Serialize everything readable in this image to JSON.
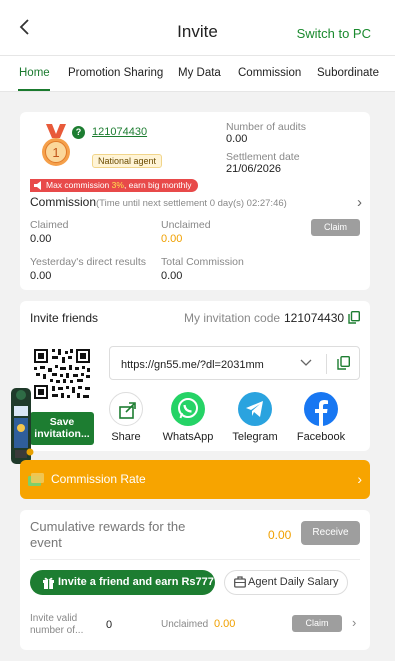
{
  "header": {
    "title": "Invite",
    "back_icon": "chevron-left-icon",
    "switch_label": "Switch to PC"
  },
  "tabs": [
    {
      "label": "Home",
      "active": true
    },
    {
      "label": "Promotion Sharing",
      "active": false
    },
    {
      "label": "My Data",
      "active": false
    },
    {
      "label": "Commission",
      "active": false
    },
    {
      "label": "Subordinate",
      "active": false
    }
  ],
  "agent": {
    "level": "1",
    "uid": "121074430",
    "tag": "National agent",
    "audits_label": "Number of audits",
    "audits_value": "0.00",
    "settlement_label": "Settlement date",
    "settlement_value": "21/06/2026"
  },
  "commission": {
    "banner_prefix": "Max commission ",
    "banner_pct": "3%",
    "banner_suffix": ", earn big monthly",
    "title": "Commission",
    "subtitle": "(Time until next settlement  0 day(s) 02:27:46)",
    "claimed_label": "Claimed",
    "claimed_value": "0.00",
    "unclaimed_label": "Unclaimed",
    "unclaimed_value": "0.00",
    "claim_button": "Claim",
    "yesterday_label": "Yesterday's direct results",
    "yesterday_value": "0.00",
    "total_label": "Total Commission",
    "total_value": "0.00"
  },
  "invite": {
    "title": "Invite friends",
    "code_label": "My invitation code",
    "code_value": "121074430",
    "save_button": "Save invitation...",
    "url": "https://gn55.me/?dl=2031mm",
    "share": [
      {
        "label": "Share",
        "icon": "share-icon",
        "color": "#ffffff"
      },
      {
        "label": "WhatsApp",
        "icon": "whatsapp-icon",
        "color": "#25d366"
      },
      {
        "label": "Telegram",
        "icon": "telegram-icon",
        "color": "#2aa3df"
      },
      {
        "label": "Facebook",
        "icon": "facebook-icon",
        "color": "#1877f2"
      }
    ]
  },
  "rate": {
    "label": "Commission Rate",
    "color": "#f7a400"
  },
  "rewards": {
    "cumulative_label": "Cumulative rewards for the event",
    "cumulative_value": "0.00",
    "receive_button": "Receive",
    "invite_button": "Invite a friend and earn Rs777",
    "salary_button": "Agent Daily Salary",
    "valid_label": "Invite valid number of...",
    "valid_value": "0",
    "unclaimed_label": "Unclaimed",
    "unclaimed_value": "0.00",
    "claim_button": "Claim"
  },
  "colors": {
    "primary_green": "#1d7d31",
    "accent_orange": "#f0a000",
    "promo_red": "#e84a4a",
    "button_grey": "#9e9e9e"
  }
}
